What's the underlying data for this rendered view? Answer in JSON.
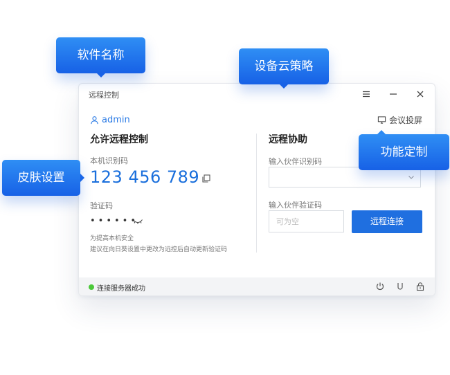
{
  "callouts": {
    "software_name": "软件名称",
    "device_cloud_policy": "设备云策略",
    "skin_settings": "皮肤设置",
    "feature_customization": "功能定制"
  },
  "window": {
    "title": "远程控制",
    "controls": [
      "menu-icon",
      "minimize-icon",
      "close-icon"
    ]
  },
  "user": {
    "name": "admin",
    "icon": "user-icon"
  },
  "meeting": {
    "label": "会议投屏",
    "icon": "screen-cast-icon"
  },
  "allow_panel": {
    "title": "允许远程控制",
    "id_label": "本机识别码",
    "id_value": "123 456 789",
    "code_label": "验证码",
    "code_value": "••••••",
    "note_line1": "为提高本机安全",
    "note_line2": "建议在向日葵设置中更改为远控后自动更新验证码"
  },
  "assist_panel": {
    "title": "远程协助",
    "partner_id_label": "输入伙伴识别码",
    "partner_id_value": "",
    "partner_code_label": "输入伙伴验证码",
    "partner_code_placeholder": "可为空",
    "connect_label": "远程连接"
  },
  "status": {
    "text": "连接服务器成功",
    "state_color": "#4cc93a",
    "icons": [
      "power-icon",
      "usb-icon",
      "lock-icon"
    ]
  },
  "colors": {
    "accent": "#1f6fe0",
    "callout": "#1761e6"
  }
}
